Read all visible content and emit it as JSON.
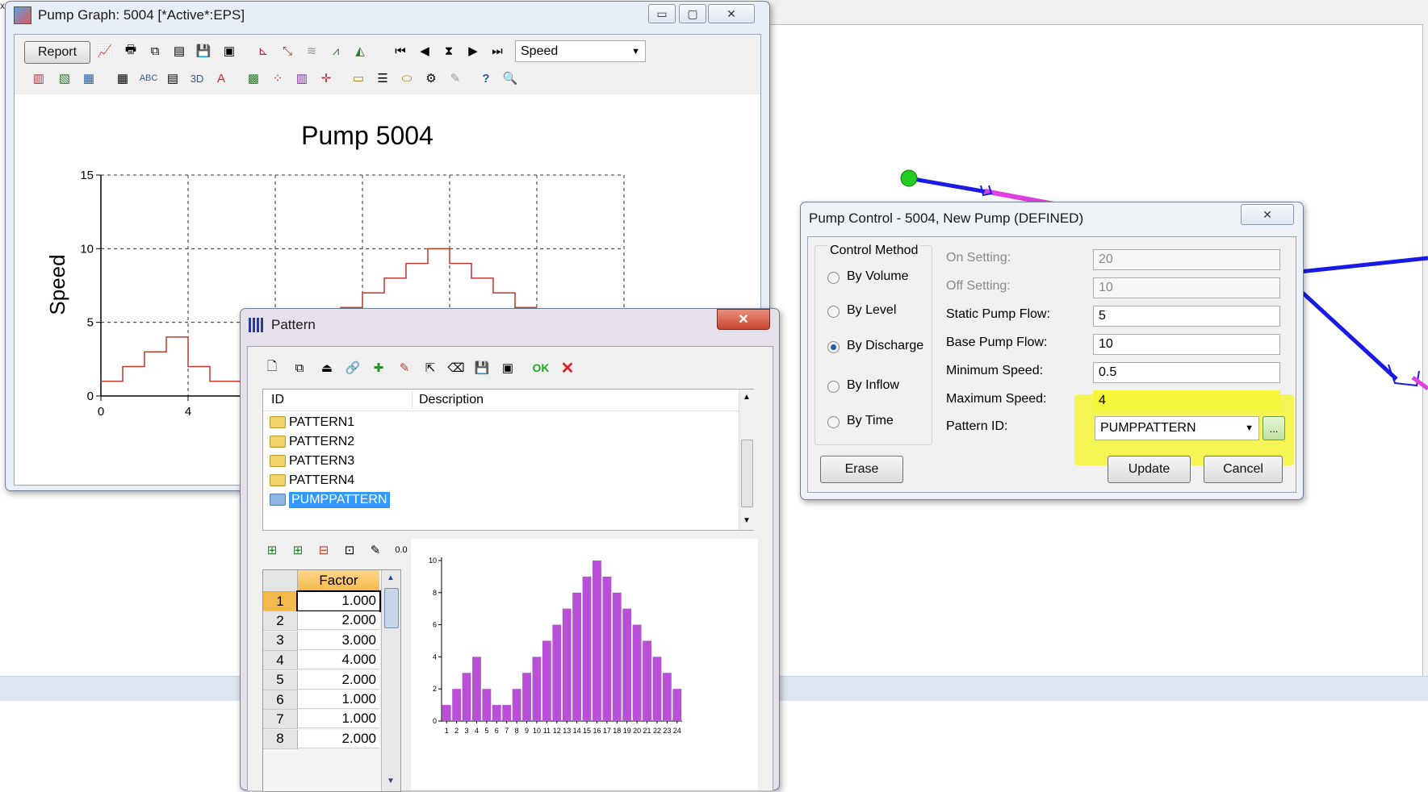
{
  "pump_graph": {
    "title": "Pump Graph: 5004 [*Active*:EPS]",
    "report_button": "Report",
    "variable_select": "Speed",
    "chart_title": "Pump 5004",
    "y_label": "Speed",
    "y_ticks": [
      "0",
      "5",
      "10",
      "15"
    ],
    "x_ticks": [
      "0",
      "4"
    ]
  },
  "chart_data": [
    {
      "type": "line",
      "title": "Pump 5004",
      "xlabel": "",
      "ylabel": "Speed",
      "ylim": [
        0,
        15
      ],
      "x_visible_ticks": [
        0,
        4
      ],
      "step_values": [
        1,
        2,
        3,
        4,
        2,
        1,
        1,
        2,
        3,
        4,
        5,
        6,
        7,
        8,
        9,
        10,
        9,
        8,
        7,
        6
      ],
      "grid": "dashed",
      "line_color": "#c0392b"
    },
    {
      "type": "bar",
      "categories": [
        "1",
        "2",
        "3",
        "4",
        "5",
        "6",
        "7",
        "8",
        "9",
        "10",
        "11",
        "12",
        "13",
        "14",
        "15",
        "16",
        "17",
        "18",
        "19",
        "20",
        "21",
        "22",
        "23",
        "24"
      ],
      "values": [
        1,
        2,
        3,
        4,
        2,
        1,
        1,
        2,
        3,
        4,
        5,
        6,
        7,
        8,
        9,
        10,
        9,
        8,
        7,
        6,
        5,
        4,
        3,
        2
      ],
      "ylim": [
        0,
        10
      ],
      "y_ticks": [
        "0",
        "2",
        "4",
        "6",
        "8",
        "10"
      ],
      "bar_color": "#b84fd6",
      "title": "",
      "xlabel": "",
      "ylabel": ""
    }
  ],
  "pattern": {
    "title": "Pattern",
    "ok_label": "OK",
    "cancel_label": "✕",
    "col_id": "ID",
    "col_description": "Description",
    "items": [
      "PATTERN1",
      "PATTERN2",
      "PATTERN3",
      "PATTERN4",
      "PUMPPATTERN"
    ],
    "selected": "PUMPPATTERN",
    "grid_header": "Factor",
    "rows": [
      {
        "num": "1",
        "factor": "1.000"
      },
      {
        "num": "2",
        "factor": "2.000"
      },
      {
        "num": "3",
        "factor": "3.000"
      },
      {
        "num": "4",
        "factor": "4.000"
      },
      {
        "num": "5",
        "factor": "2.000"
      },
      {
        "num": "6",
        "factor": "1.000"
      },
      {
        "num": "7",
        "factor": "1.000"
      },
      {
        "num": "8",
        "factor": "2.000"
      }
    ]
  },
  "pump_control": {
    "title": "Pump Control - 5004, New Pump (DEFINED)",
    "group_label": "Control Method",
    "methods": [
      "By Volume",
      "By Level",
      "By Discharge",
      "By Inflow",
      "By Time"
    ],
    "selected_method": "By Discharge",
    "on_setting_label": "On Setting:",
    "on_setting_value": "20",
    "off_setting_label": "Off Setting:",
    "off_setting_value": "10",
    "static_flow_label": "Static Pump Flow:",
    "static_flow_value": "5",
    "base_flow_label": "Base Pump Flow:",
    "base_flow_value": "10",
    "min_speed_label": "Minimum Speed:",
    "min_speed_value": "0.5",
    "max_speed_label": "Maximum Speed:",
    "max_speed_value": "4",
    "pattern_id_label": "Pattern ID:",
    "pattern_id_value": "PUMPPATTERN",
    "browse_label": "...",
    "erase_label": "Erase",
    "update_label": "Update",
    "cancel_label": "Cancel",
    "highlight_color": "#f5f53a"
  },
  "colors": {
    "network_pipe": "#1a1ae6",
    "network_node": "#22cc22",
    "network_highlight": "#e040e0"
  }
}
